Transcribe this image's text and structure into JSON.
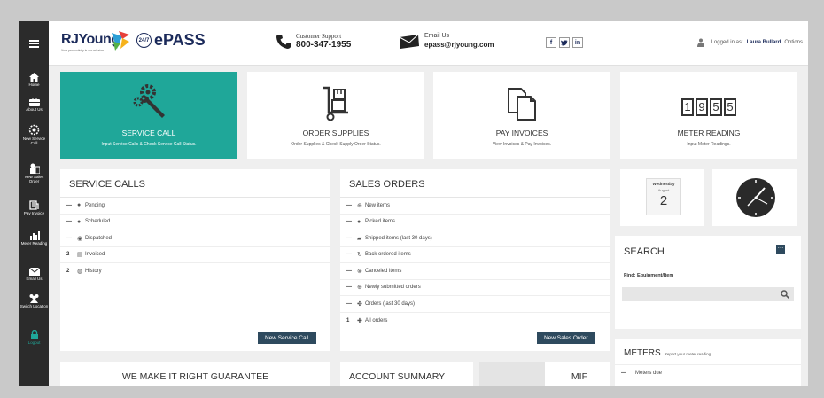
{
  "header": {
    "logo": "RJYoung",
    "logo_tagline": "Your productivity is our mission",
    "epass_badge": "24/7",
    "epass": "ePASS",
    "support_label": "Customer Support",
    "support_phone": "800-347-1955",
    "email_label": "Email Us",
    "email": "epass@rjyoung.com",
    "social": [
      "f",
      "t",
      "in"
    ],
    "logged_in_label": "Logged in as:",
    "user_name": "Laura Bullard",
    "options": "Options"
  },
  "sidebar": {
    "items": [
      {
        "label": "Home"
      },
      {
        "label": "About Us"
      },
      {
        "label": "New Service Call"
      },
      {
        "label": "New Sales Order"
      },
      {
        "label": "Pay Invoice"
      },
      {
        "label": "Meter Reading"
      },
      {
        "label": "Email Us"
      },
      {
        "label": "Switch Location"
      },
      {
        "label": "Logout"
      }
    ]
  },
  "tiles": [
    {
      "title": "SERVICE CALL",
      "subtitle": "Input Service Calls & Check Service Call Status.",
      "icon": "gears-wrench-icon"
    },
    {
      "title": "ORDER SUPPLIES",
      "subtitle": "Order Supplies & Check Supply Order Status.",
      "icon": "hand-truck-icon"
    },
    {
      "title": "PAY INVOICES",
      "subtitle": "View Invoices & Pay Invoices.",
      "icon": "documents-icon"
    },
    {
      "title": "METER READING",
      "subtitle": "Input Meter Readings.",
      "icon": "meter-counter-icon",
      "digits": [
        "1",
        "9",
        "5",
        "5"
      ]
    }
  ],
  "service_calls": {
    "title": "SERVICE CALLS",
    "rows": [
      {
        "count": "—",
        "label": "Pending"
      },
      {
        "count": "—",
        "label": "Scheduled"
      },
      {
        "count": "—",
        "label": "Dispatched"
      },
      {
        "count": "2",
        "label": "Invoiced"
      },
      {
        "count": "2",
        "label": "History"
      }
    ],
    "button": "New Service Call"
  },
  "sales_orders": {
    "title": "SALES ORDERS",
    "rows": [
      {
        "count": "—",
        "label": "New items"
      },
      {
        "count": "—",
        "label": "Picked items"
      },
      {
        "count": "—",
        "label": "Shipped items (last 30 days)"
      },
      {
        "count": "—",
        "label": "Back ordered items"
      },
      {
        "count": "—",
        "label": "Canceled items"
      },
      {
        "count": "—",
        "label": "Newly submitted orders"
      },
      {
        "count": "—",
        "label": "Orders (last 30 days)"
      },
      {
        "count": "1",
        "label": "All orders"
      }
    ],
    "button": "New Sales Order"
  },
  "calendar": {
    "weekday": "Wednesday",
    "month": "August",
    "day": "2"
  },
  "search": {
    "title": "SEARCH",
    "find_label": "Find: Equipment/Item",
    "placeholder": ""
  },
  "meters": {
    "title": "METERS",
    "subtitle": "Report your meter reading",
    "rows": [
      {
        "count": "—",
        "label": "Meters due"
      }
    ]
  },
  "bottom": {
    "guarantee": "WE MAKE IT RIGHT GUARANTEE",
    "account": "ACCOUNT SUMMARY",
    "mif": "MIF"
  },
  "colors": {
    "accent": "#1fa799",
    "sidebar": "#2b2b2b",
    "button": "#2e4a5e",
    "logout": "#1fa799"
  }
}
